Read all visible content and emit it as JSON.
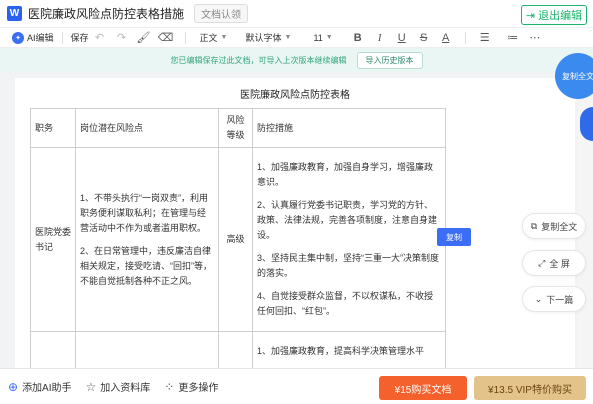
{
  "titlebar": {
    "logo": "W",
    "title": "医院廉政风险点防控表格措施",
    "badge": "文档认领",
    "exit_label": "退出编辑",
    "exit_icon": "exit-icon"
  },
  "toolbar": {
    "ai_label": "AI编辑",
    "save_label": "保存",
    "style_select": "正文",
    "font_select": "默认字体",
    "size_select": "11",
    "icons": [
      "undo-icon",
      "redo-icon",
      "format-painter-icon",
      "eraser-icon",
      "bold-icon",
      "italic-icon",
      "underline-icon",
      "strikethrough-icon",
      "font-color-icon",
      "align-icon",
      "list-icon",
      "more-icon"
    ]
  },
  "infobar": {
    "message": "您已编辑保存过此文档，可导入上次版本继续编辑",
    "import_label": "导入历史版本"
  },
  "document": {
    "table_title": "医院廉政风险点防控表格",
    "headers": [
      "职务",
      "岗位潜在风险点",
      "风险等级",
      "防控措施"
    ],
    "row1": {
      "position": "医院党委书记",
      "risks": [
        "1、不带头执行“一岗双责”，利用职务便利谋取私利；在管理与经营活动中不作为或者滥用职权。",
        "2、在日常管理中，违反廉洁自律相关规定，接受吃请、“回扣”等，不能自觉抵制各种不正之风。"
      ],
      "level": "高级",
      "measures": [
        "1、加强廉政教育，加强自身学习，增强廉政意识。",
        "2、认真履行党委书记职责，学习党的方针、政策、法律法规，完善各项制度，注意自身建设。",
        "3、坚持民主集中制，坚持“三重一大”决策制度的落实。",
        "4、自觉接受群众监督，不以权谋私，不收授任何回扣、“红包”。"
      ]
    },
    "row2": {
      "measures_partial": "1、加强廉政教育，提高科学决策管理水平"
    },
    "copy_float": "复制"
  },
  "side": {
    "copy_all_circle": "复制全文",
    "copy_all": "复制全文",
    "fullscreen": "全 屏",
    "next": "下一篇"
  },
  "bottombar": {
    "ai_helper": "添加AI助手",
    "add_library": "加入资料库",
    "more": "更多操作",
    "buy_doc": "¥15购买文档",
    "vip": "¥13.5 VIP特价购买"
  },
  "colors": {
    "accent": "#3b6ef5",
    "exit": "#19b36b",
    "buy": "#f5612d",
    "vip": "#e4c38b"
  }
}
